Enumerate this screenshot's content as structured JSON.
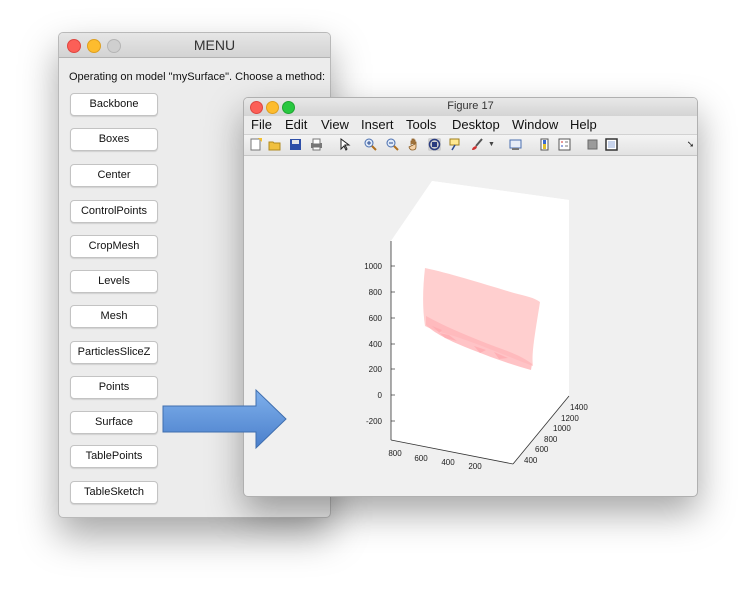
{
  "menu_window": {
    "title": "MENU",
    "prompt": "Operating on model \"mySurface\". Choose a method:",
    "methods": [
      "Backbone",
      "Boxes",
      "Center",
      "ControlPoints",
      "CropMesh",
      "Levels",
      "Mesh",
      "ParticlesSliceZ",
      "Points",
      "Surface",
      "TablePoints",
      "TableSketch"
    ]
  },
  "figure_window": {
    "title": "Figure 17",
    "menu": [
      "File",
      "Edit",
      "View",
      "Insert",
      "Tools",
      "Desktop",
      "Window",
      "Help"
    ],
    "toolbar": [
      "new-figure-icon",
      "open-file-icon",
      "save-icon",
      "print-icon",
      "pointer-icon",
      "zoom-in-icon",
      "zoom-out-icon",
      "pan-hand-icon",
      "rotate-3d-icon",
      "data-cursor-icon",
      "brush-icon",
      "brush-dropdown-icon",
      "link-plot-icon",
      "colorbar-icon",
      "legend-icon",
      "hide-plot-tools-icon",
      "show-plot-tools-icon",
      "dock-icon"
    ],
    "axes": {
      "z_ticks": [
        "1000",
        "800",
        "600",
        "400",
        "200",
        "0",
        "-200"
      ],
      "x_ticks": [
        "800",
        "600",
        "400",
        "200"
      ],
      "y_ticks": [
        "1400",
        "1200",
        "1000",
        "800",
        "600",
        "400"
      ]
    },
    "surface_color": "#ffc9c9"
  },
  "colors": {
    "arrow": "#5b8fd4",
    "close": "#fc5f57",
    "minimize": "#fdbc2e",
    "zoom": "#28c840"
  }
}
